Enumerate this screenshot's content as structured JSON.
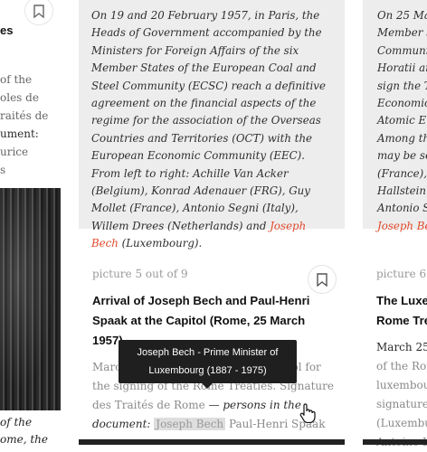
{
  "left_card": {
    "title": "es",
    "text_lines": [
      "of the",
      "oles de",
      "raités de",
      "ument:",
      "urice",
      "s"
    ],
    "caption_lines": [
      "of the",
      "ome, the"
    ]
  },
  "center_card": {
    "desc_part1": "On 19 and 20 February 1957, in Paris, the Heads of Government accompanied by the Ministers for Foreign Affairs of the six Member States of the European Coal and Steel Community (ECSC) reach a definitive agreement on the financial aspects of the regime for the association of the Overseas Countries and Territories (OCT) with the European Economic Community (EEC). From left to right: Achille Van Acker (Belgium), Konrad Adenauer (FRG), Guy Mollet (France), Antonio Segni (Italy), Willem Drees (Netherlands) and ",
    "desc_link": "Joseph Bech",
    "desc_part2": " (Luxembourg).",
    "counter": "picture 5 out of 9",
    "title": "Arrival of Joseph Bech and Paul-Henri Spaak at the Capitol (Rome, 25 March 1957)",
    "body_text": "March 25, 1957, arrival at the Capitol for the signing of the Rome Treaties. Signature des Traités de Rome",
    "persons_label": "— persons in the document:",
    "person_1": "Joseph Bech",
    "person_2": "Paul-Henri Spaak"
  },
  "tooltip": {
    "line1": "Joseph Bech - Prime Minister of",
    "line2": "Luxembourg (1887 - 1975)"
  },
  "right_card": {
    "desc_lines": [
      "On 25 Marc",
      "Member S",
      "Communit",
      "Horatii an",
      "sign the T",
      "Economic",
      "Atomic En",
      "Among the",
      "may be se",
      "(France), F",
      "Hallstein (",
      "Antonio Se"
    ],
    "desc_link": "Joseph Bec",
    "counter": "picture 6 o",
    "title_lines": [
      "The Luxe",
      "Rome Tre"
    ],
    "body_lines": [
      "March 25,",
      "of the Ron",
      "luxembou",
      "signature",
      "(Luxembu",
      "Antoine Le"
    ]
  },
  "colors": {
    "link": "#e04b2c",
    "card_bg": "#ededed",
    "tooltip_bg": "#1f1f1f"
  },
  "icons": [
    "bookmark-icon",
    "hand-pointer-icon"
  ]
}
